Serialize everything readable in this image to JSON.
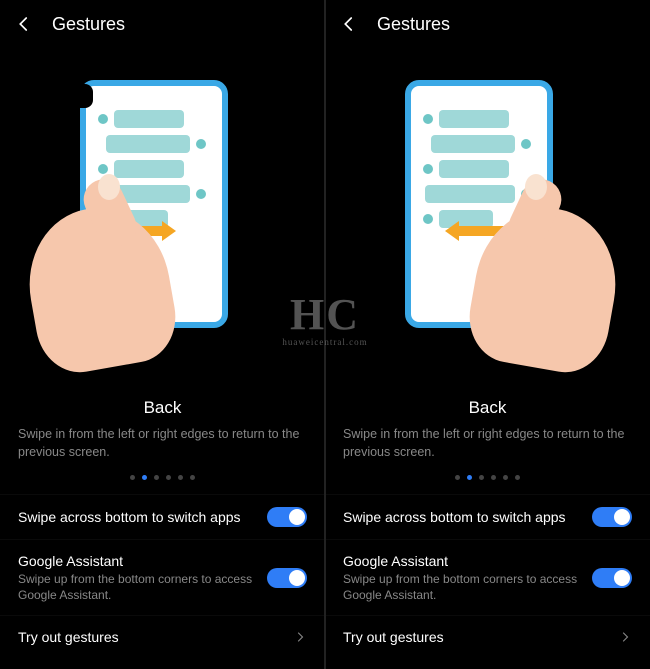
{
  "header": {
    "title": "Gestures"
  },
  "gesture": {
    "title": "Back",
    "description": "Swipe in from the left or right edges to return to the previous screen."
  },
  "pager": {
    "count": 6,
    "active_index": 1
  },
  "settings": {
    "swipe_bottom": {
      "label": "Swipe across bottom to switch apps",
      "on": true
    },
    "assistant": {
      "label": "Google Assistant",
      "desc": "Swipe up from the bottom corners to access Google Assistant.",
      "on": true
    },
    "tryout": {
      "label": "Try out gestures"
    }
  },
  "watermark": {
    "main": "HC",
    "sub": "huaweicentral.com"
  },
  "colors": {
    "accent": "#2f7df6",
    "phone_frame": "#3aa8e6",
    "arrow": "#f5a623",
    "skin": "#f6c7ac"
  }
}
